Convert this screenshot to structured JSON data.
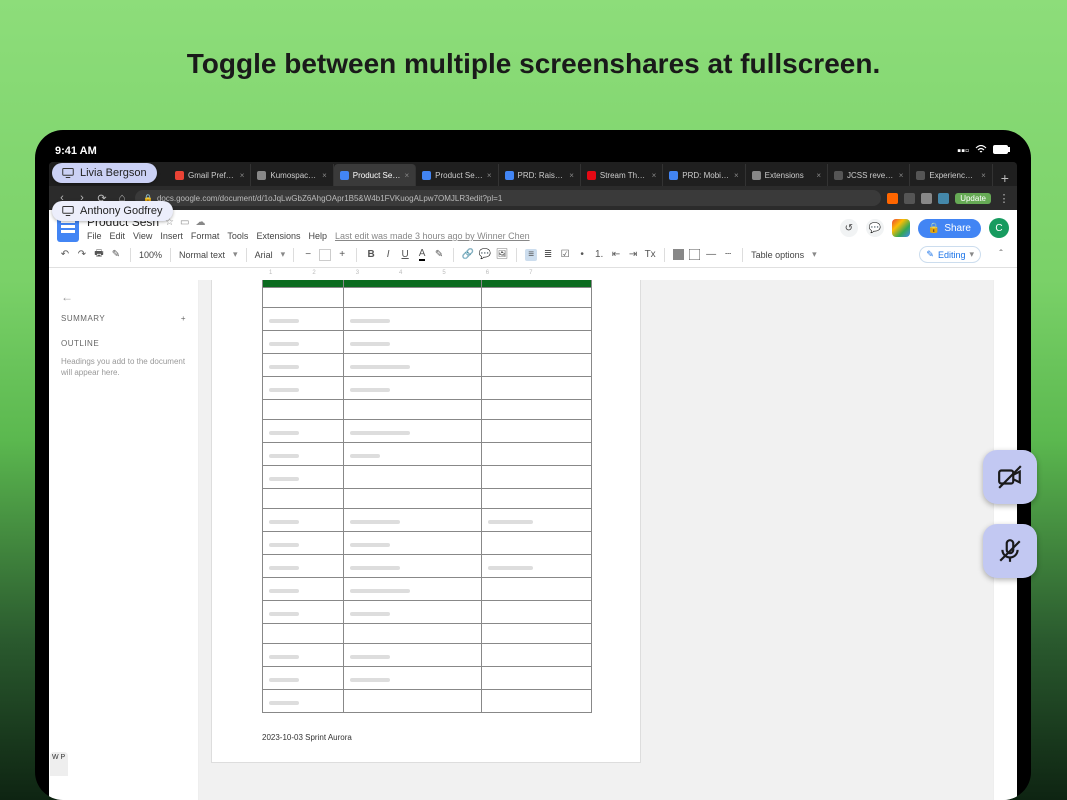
{
  "headline": "Toggle between multiple screenshares at fullscreen.",
  "status": {
    "time": "9:41 AM",
    "wifi": "wifi",
    "signal": "signal",
    "battery": "battery"
  },
  "presenters": [
    {
      "name": "Livia Bergson"
    },
    {
      "name": "Anthony Godfrey"
    }
  ],
  "tabs": [
    {
      "label": "Gmail Preference C...",
      "favColor": "#ea4335"
    },
    {
      "label": "Kumospace—Cal...",
      "favColor": "#888"
    },
    {
      "label": "Product Sesh - ...",
      "favColor": "#4285f4",
      "active": true
    },
    {
      "label": "Product Sesh—G...",
      "favColor": "#4285f4"
    },
    {
      "label": "PRD: Raise Hand ...",
      "favColor": "#4285f4"
    },
    {
      "label": "Stream The Nation...",
      "favColor": "#e50914"
    },
    {
      "label": "PRD: Mobile App - ...",
      "favColor": "#4285f4"
    },
    {
      "label": "Extensions",
      "favColor": "#888"
    },
    {
      "label": "JCSS reveals insi...",
      "favColor": "#555"
    },
    {
      "label": "Experience a Matur...",
      "favColor": "#555"
    }
  ],
  "url": "docs.google.com/document/d/1oJqLwGbZ6AhgOApr1B5&W4b1FVKuogALpw7OMJLR3edit?pl=1",
  "updateLabel": "Update",
  "doc": {
    "title": "Product Sesh",
    "menus": [
      "File",
      "Edit",
      "View",
      "Insert",
      "Format",
      "Tools",
      "Extensions",
      "Help"
    ],
    "lastEdit": "Last edit was made 3 hours ago by Winner Chen",
    "share": "Share",
    "avatar": "C",
    "editing": "Editing",
    "zoom": "100%",
    "style": "Normal text",
    "font": "Arial",
    "tableOptions": "Table options"
  },
  "outline": {
    "summary": "SUMMARY",
    "plus": "+",
    "title": "OUTLINE",
    "hint": "Headings you add to the document will appear here."
  },
  "footnote": "2023-10-03  Sprint Aurora",
  "floatButtons": {
    "camera": "camera-off",
    "mic": "mic-off"
  },
  "bottomTab": "W P"
}
